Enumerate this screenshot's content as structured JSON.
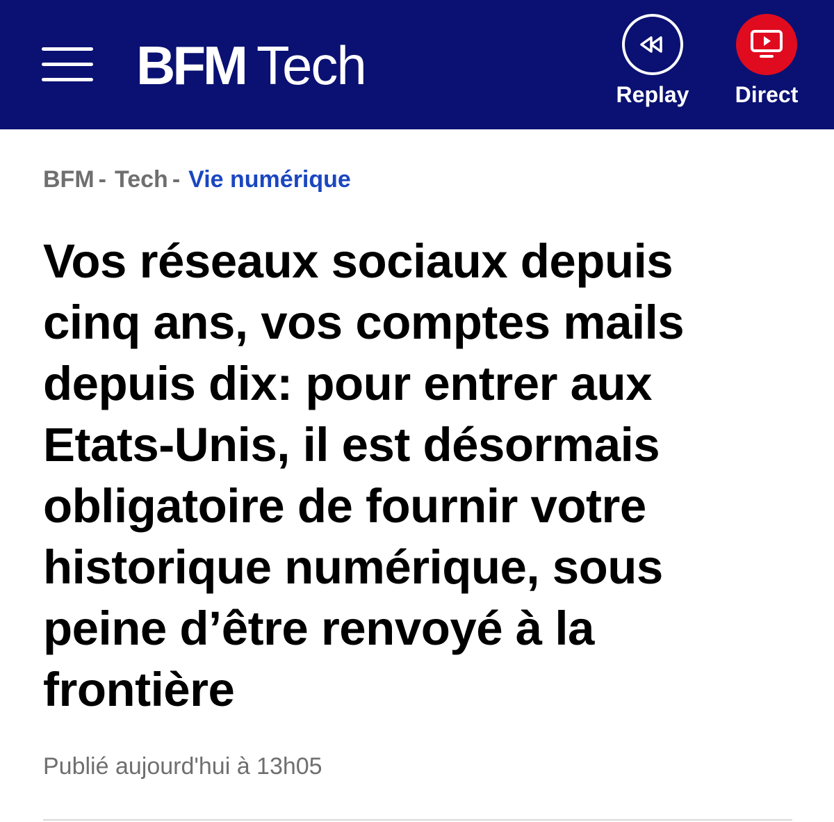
{
  "header": {
    "menu_icon": "hamburger-menu-icon",
    "logo": {
      "brand": "BFM",
      "section": "Tech"
    },
    "actions": [
      {
        "label": "Replay",
        "icon": "rewind-icon"
      },
      {
        "label": "Direct",
        "icon": "tv-play-icon"
      }
    ],
    "colors": {
      "background": "#0a1172",
      "direct_accent": "#e10b1f"
    }
  },
  "breadcrumb": {
    "items": [
      {
        "label": "BFM"
      },
      {
        "label": "Tech"
      },
      {
        "label": "Vie numérique"
      }
    ],
    "separator": "-",
    "active_color": "#1b46c1"
  },
  "article": {
    "title": "Vos réseaux sociaux depuis cinq ans, vos comptes mails depuis dix: pour entrer aux Etats-Unis, il est désormais obligatoire de fournir votre historique numérique, sous peine d’être renvoyé à la frontière",
    "published": "Publié aujourd'hui à 13h05"
  }
}
